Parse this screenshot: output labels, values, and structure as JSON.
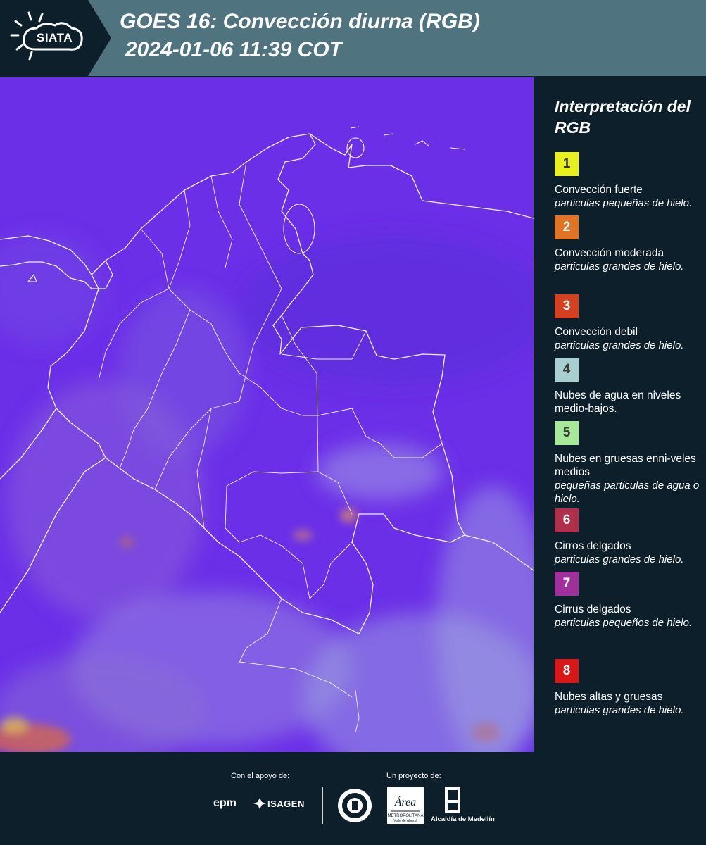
{
  "header": {
    "logo_text": "SIATA",
    "title_line1": "GOES 16: Convección diurna (RGB)",
    "title_line2": "2024-01-06 11:39 COT",
    "bg_color": "#4f7480"
  },
  "map": {
    "base_color": "#6b2fe8"
  },
  "legend": {
    "title": "Interpretación del RGB",
    "items": [
      {
        "number": "1",
        "color": "#e8f020",
        "label": "Convección fuerte",
        "sub": "particulas pequeñas de hielo."
      },
      {
        "number": "2",
        "color": "#e07424",
        "label": "Convección moderada",
        "sub": "particulas grandes de hielo."
      },
      {
        "number": "3",
        "color": "#d44020",
        "label": "Convección debil",
        "sub": "particulas grandes de hielo."
      },
      {
        "number": "4",
        "color": "#a8d0d0",
        "label": "Nubes de agua en niveles medio-bajos.",
        "sub": ""
      },
      {
        "number": "5",
        "color": "#a8e89a",
        "label": "Nubes en gruesas enni-veles medios",
        "sub": "pequeñas particulas de agua o hielo."
      },
      {
        "number": "6",
        "color": "#b0304c",
        "label": "Cirros delgados",
        "sub": "particulas grandes de hielo."
      },
      {
        "number": "7",
        "color": "#a0309c",
        "label": "Cirrus delgados",
        "sub": "particulas pequeños de hielo."
      },
      {
        "number": "8",
        "color": "#d81818",
        "label": "Nubes altas y gruesas",
        "sub": "particulas grandes de hielo."
      }
    ]
  },
  "footer": {
    "support_label": "Con el apoyo de:",
    "project_label": "Un proyecto de:",
    "epm": "epm",
    "isagen": "ISAGEN",
    "area_label": "Área",
    "area_sub1": "METROPOLITANA",
    "area_sub2": "Valle de Aburrá",
    "alcaldia": "Alcaldía de Medellín"
  }
}
